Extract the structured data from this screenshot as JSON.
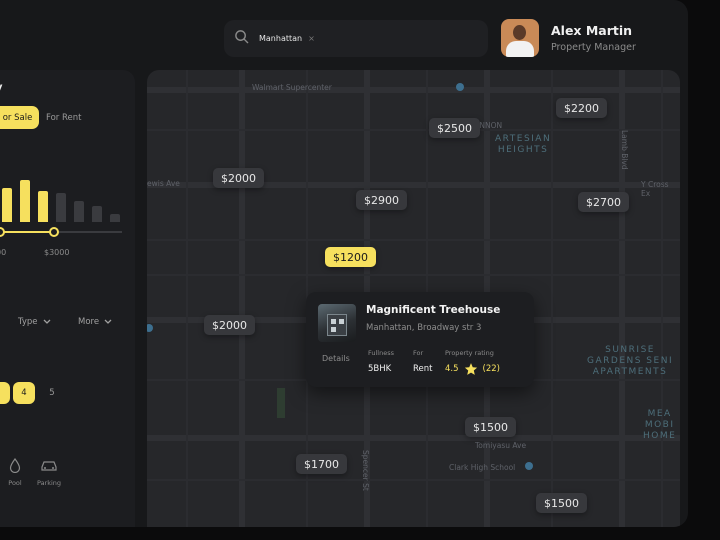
{
  "search": {
    "chip": "Manhattan",
    "chip_close": "×"
  },
  "profile": {
    "name": "Alex Martin",
    "role": "Property Manager"
  },
  "filters": {
    "title": "y",
    "segment": {
      "sale": "or Sale",
      "rent": "For Rent"
    },
    "histogram": [
      {
        "value": 0.65,
        "active": true
      },
      {
        "value": 0.8,
        "active": true
      },
      {
        "value": 0.6,
        "active": true
      },
      {
        "value": 0.55,
        "active": false
      },
      {
        "value": 0.4,
        "active": false
      },
      {
        "value": 0.3,
        "active": false
      },
      {
        "value": 0.15,
        "active": false
      }
    ],
    "price_min": "00",
    "price_max": "$3000",
    "dropdowns": [
      "Type",
      "More"
    ],
    "pages": [
      "4",
      "5"
    ],
    "pages_active": "4",
    "amenities": [
      "Pool",
      "Parking"
    ]
  },
  "map": {
    "streets": [
      "Walmart Supercenter",
      "ewis Ave",
      "Y Cross Ex",
      "Clark High School",
      "Tomiyasu Ave",
      "CANNON",
      "Spencer St",
      "Lamb Blvd"
    ],
    "areas": [
      "ARTESIAN\nHEIGHTS",
      "SUNRISE\nGARDENS SENI\nAPARTMENTS",
      "MEA\nMOBI\nHOME"
    ],
    "prices": [
      "$2200",
      "$2500",
      "$2000",
      "$2900",
      "$2700",
      "$1200",
      "$2000",
      "$1500",
      "$1700",
      "$1500"
    ],
    "active_price": "$1200"
  },
  "card": {
    "title": "Magnificent Treehouse",
    "address": "Manhattan, Broadway str 3",
    "details": "Details",
    "fullness_label": "Fullness",
    "fullness_value": "5BHK",
    "for_label": "For",
    "for_value": "Rent",
    "rating_label": "Property rating",
    "rating_value": "4.5",
    "rating_count": "(22)"
  },
  "colors": {
    "accent": "#f6e05e",
    "background": "#17181a",
    "map": "#26272a",
    "pin": "#37383c"
  }
}
